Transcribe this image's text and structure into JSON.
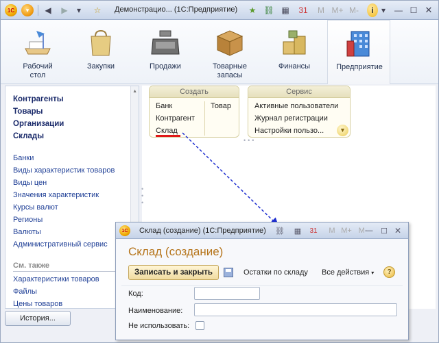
{
  "main_window": {
    "title": "Демонстрацио... (1С:Предприятие)",
    "toolbar": {
      "m": "M",
      "mplus": "M+",
      "mminus": "M-",
      "info": "i"
    }
  },
  "sections": [
    {
      "label": "Рабочий\nстол",
      "icon": "desk-lamp-icon"
    },
    {
      "label": "Закупки",
      "icon": "shopping-bag-icon"
    },
    {
      "label": "Продажи",
      "icon": "cash-register-icon"
    },
    {
      "label": "Товарные\nзапасы",
      "icon": "box-icon"
    },
    {
      "label": "Финансы",
      "icon": "coins-icon"
    },
    {
      "label": "Предприятие",
      "icon": "building-icon",
      "active": true
    }
  ],
  "nav": {
    "bold_items": [
      "Контрагенты",
      "Товары",
      "Организации",
      "Склады"
    ],
    "links": [
      "Банки",
      "Виды характеристик товаров",
      "Виды цен",
      "Значения характеристик",
      "Курсы валют",
      "Регионы",
      "Валюты",
      "Административный сервис"
    ],
    "see_also_title": "См. также",
    "see_also": [
      "Характеристики товаров",
      "Файлы",
      "Цены товаров"
    ]
  },
  "groups": {
    "create": {
      "title": "Создать",
      "col1": [
        "Банк",
        "Контрагент",
        "Склад"
      ],
      "col2": [
        "Товар"
      ]
    },
    "service": {
      "title": "Сервис",
      "items": [
        "Активные пользователи",
        "Журнал регистрации",
        "Настройки пользо..."
      ]
    }
  },
  "history_button": "История...",
  "child_window": {
    "title": "Склад (создание) (1С:Предприятие)",
    "heading": "Склад (создание)",
    "save_close": "Записать и закрыть",
    "stock_link": "Остатки по складу",
    "all_actions": "Все действия",
    "help": "?",
    "fields": {
      "code_label": "Код:",
      "code_value": "",
      "name_label": "Наименование:",
      "name_value": "",
      "unused_label": "Не использовать:",
      "unused_checked": false
    },
    "toolbar": {
      "m": "M",
      "mplus": "M+",
      "mminus": "M-"
    }
  },
  "colors": {
    "accent_heading": "#b5741a",
    "link": "#1f3f96",
    "highlight_underline": "#e01818",
    "arrow": "#2030d0"
  }
}
